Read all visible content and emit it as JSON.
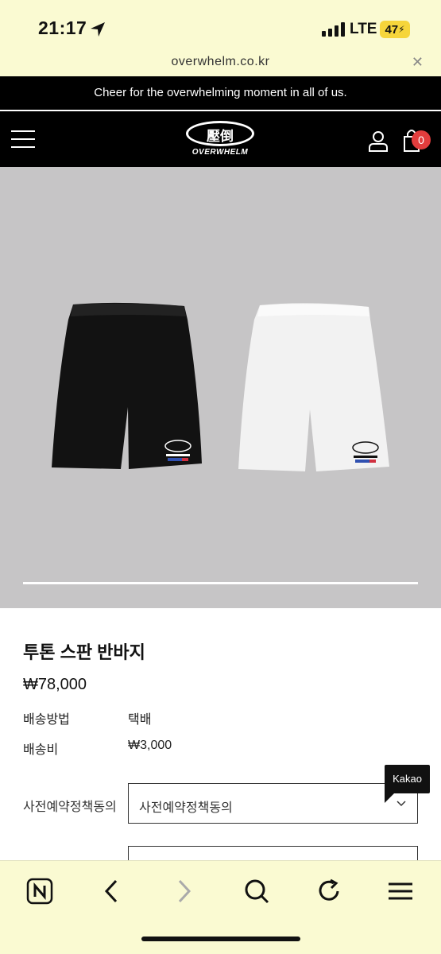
{
  "status_bar": {
    "time": "21:17",
    "network": "LTE",
    "battery": "47"
  },
  "browser": {
    "url": "overwhelm.co.kr"
  },
  "announcement": "Cheer for the overwhelming moment in all of us.",
  "header": {
    "logo_kanji": "壓倒",
    "logo_word": "OVERWHELM",
    "cart_count": "0"
  },
  "product": {
    "title": "투톤 스판 반바지",
    "price": "₩78,000",
    "shipping_method_label": "배송방법",
    "shipping_method_value": "택배",
    "shipping_fee_label": "배송비",
    "shipping_fee_value": "₩3,000",
    "option_label": "사전예약정책동의",
    "option_selected": "사전예약정책동의"
  },
  "kakao_label": "Kakao",
  "colors": {
    "browser_bar": "#fafad2",
    "gallery_bg": "#c6c5c6",
    "badge": "#e23d3d"
  }
}
